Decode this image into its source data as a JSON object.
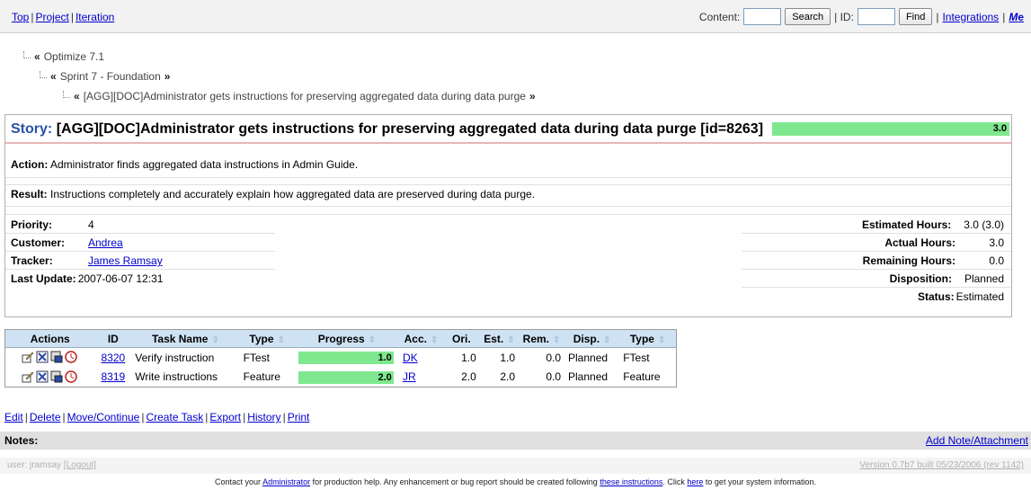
{
  "topnav": {
    "top": "Top",
    "project": "Project",
    "iteration": "Iteration"
  },
  "search": {
    "content_label": "Content:",
    "content_value": "",
    "search_button": "Search",
    "id_label": "| ID:",
    "id_value": "",
    "find_button": "Find",
    "integrations": "Integrations",
    "me": "Me"
  },
  "breadcrumb": {
    "project": "Optimize 7.1",
    "iteration": "Sprint 7 - Foundation",
    "story": "[AGG][DOC]Administrator gets instructions for preserving aggregated data during data purge"
  },
  "story": {
    "title_prefix": "Story:",
    "title": "[AGG][DOC]Administrator gets instructions for preserving aggregated data during data purge [id=8263]",
    "progress_value": "3.0",
    "action_label": "Action:",
    "action_text": "Administrator finds aggregated data instructions in Admin Guide.",
    "result_label": "Result:",
    "result_text": "Instructions completely and accurately explain how aggregated data are preserved during data purge.",
    "priority_label": "Priority:",
    "priority": "4",
    "customer_label": "Customer:",
    "customer": "Andrea",
    "tracker_label": "Tracker:",
    "tracker": "James Ramsay",
    "last_update_label": "Last Update:",
    "last_update": "2007-06-07 12:31",
    "estimated_label": "Estimated Hours:",
    "estimated": "3.0 (3.0)",
    "actual_label": "Actual Hours:",
    "actual": "3.0",
    "remaining_label": "Remaining Hours:",
    "remaining": "0.0",
    "disposition_label": "Disposition:",
    "disposition": "Planned",
    "status_label": "Status:",
    "status": "Estimated"
  },
  "tasks": {
    "headers": [
      "Actions",
      "ID",
      "Task Name",
      "Type",
      "Progress",
      "Acc.",
      "Ori.",
      "Est.",
      "Rem.",
      "Disp.",
      "Type"
    ],
    "rows": [
      {
        "id": "8320",
        "name": "Verify instruction",
        "type": "FTest",
        "progress": "1.0",
        "progress_fraction": 1.0,
        "acc": "DK",
        "ori": "1.0",
        "est": "1.0",
        "rem": "0.0",
        "disp": "Planned",
        "type2": "FTest"
      },
      {
        "id": "8319",
        "name": "Write instructions",
        "type": "Feature",
        "progress": "2.0",
        "progress_fraction": 1.0,
        "acc": "JR",
        "ori": "2.0",
        "est": "2.0",
        "rem": "0.0",
        "disp": "Planned",
        "type2": "Feature"
      }
    ]
  },
  "page_actions": {
    "edit": "Edit",
    "delete": "Delete",
    "move": "Move/Continue",
    "create_task": "Create Task",
    "export": "Export",
    "history": "History",
    "print": "Print"
  },
  "notes": {
    "label": "Notes:",
    "add": "Add Note/Attachment"
  },
  "footer": {
    "user": "user: jramsay",
    "logout": "[Logout]",
    "version": "Version 0.7b7 built 05/23/2006 (rev 1142)",
    "contact_1": "Contact your",
    "administrator": "Administrator",
    "contact_2": "for production help. Any enhancement or bug report should be created following",
    "these_instructions": "these instructions",
    "contact_3": ". Click",
    "here": "here",
    "contact_4": "to get your system information."
  },
  "colors": {
    "progress": "#7fe88e",
    "header_bg": "#cfe2f3",
    "link": "#0000cc",
    "story_keyword": "#2a52a8"
  }
}
